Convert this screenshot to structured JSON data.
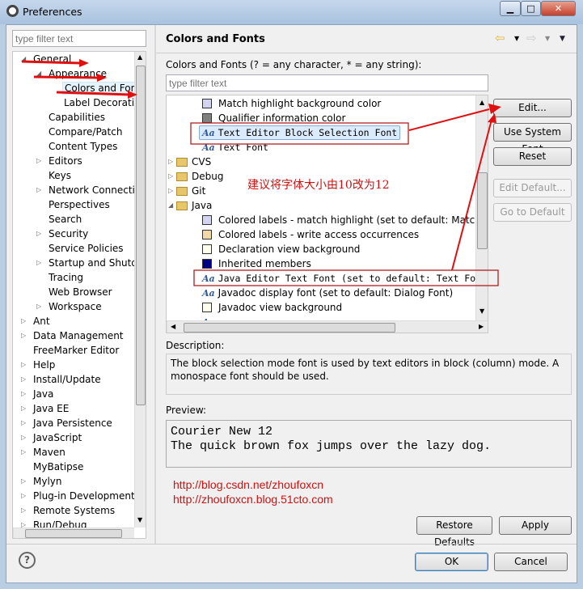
{
  "window": {
    "title": "Preferences",
    "minimize": "▁",
    "maximize": "□",
    "close": "✕"
  },
  "left": {
    "filter_placeholder": "type filter text",
    "tree": [
      {
        "label": "General",
        "level": 0,
        "state": "open"
      },
      {
        "label": "Appearance",
        "level": 1,
        "state": "open"
      },
      {
        "label": "Colors and Fonts",
        "level": 2,
        "state": "leaf",
        "selected": true
      },
      {
        "label": "Label Decorations",
        "level": 2,
        "state": "leaf"
      },
      {
        "label": "Capabilities",
        "level": 1,
        "state": "leaf"
      },
      {
        "label": "Compare/Patch",
        "level": 1,
        "state": "leaf"
      },
      {
        "label": "Content Types",
        "level": 1,
        "state": "leaf"
      },
      {
        "label": "Editors",
        "level": 1,
        "state": "closed"
      },
      {
        "label": "Keys",
        "level": 1,
        "state": "leaf"
      },
      {
        "label": "Network Connections",
        "level": 1,
        "state": "closed"
      },
      {
        "label": "Perspectives",
        "level": 1,
        "state": "leaf"
      },
      {
        "label": "Search",
        "level": 1,
        "state": "leaf"
      },
      {
        "label": "Security",
        "level": 1,
        "state": "closed"
      },
      {
        "label": "Service Policies",
        "level": 1,
        "state": "leaf"
      },
      {
        "label": "Startup and Shutdown",
        "level": 1,
        "state": "closed"
      },
      {
        "label": "Tracing",
        "level": 1,
        "state": "leaf"
      },
      {
        "label": "Web Browser",
        "level": 1,
        "state": "leaf"
      },
      {
        "label": "Workspace",
        "level": 1,
        "state": "closed"
      },
      {
        "label": "Ant",
        "level": 0,
        "state": "closed"
      },
      {
        "label": "Data Management",
        "level": 0,
        "state": "closed"
      },
      {
        "label": "FreeMarker Editor",
        "level": 0,
        "state": "leaf"
      },
      {
        "label": "Help",
        "level": 0,
        "state": "closed"
      },
      {
        "label": "Install/Update",
        "level": 0,
        "state": "closed"
      },
      {
        "label": "Java",
        "level": 0,
        "state": "closed"
      },
      {
        "label": "Java EE",
        "level": 0,
        "state": "closed"
      },
      {
        "label": "Java Persistence",
        "level": 0,
        "state": "closed"
      },
      {
        "label": "JavaScript",
        "level": 0,
        "state": "closed"
      },
      {
        "label": "Maven",
        "level": 0,
        "state": "closed"
      },
      {
        "label": "MyBatipse",
        "level": 0,
        "state": "leaf"
      },
      {
        "label": "Mylyn",
        "level": 0,
        "state": "closed"
      },
      {
        "label": "Plug-in Development",
        "level": 0,
        "state": "closed"
      },
      {
        "label": "Remote Systems",
        "level": 0,
        "state": "closed"
      },
      {
        "label": "Run/Debug",
        "level": 0,
        "state": "closed"
      }
    ]
  },
  "main": {
    "title": "Colors and Fonts",
    "hint": "Colors and Fonts (? = any character, * = any string):",
    "filter_placeholder": "type filter text",
    "items": [
      {
        "type": "color",
        "label": "Match highlight background color",
        "color": "#d4d4f0",
        "indent": 2
      },
      {
        "type": "color",
        "label": "Qualifier information color",
        "color": "#808080",
        "indent": 2
      },
      {
        "type": "font",
        "label": "Text Editor Block Selection Font",
        "mono": true,
        "selected": true,
        "indent": 2
      },
      {
        "type": "font",
        "label": "Text Font",
        "mono": true,
        "indent": 2
      },
      {
        "type": "category",
        "label": "CVS",
        "state": "closed"
      },
      {
        "type": "category",
        "label": "Debug",
        "state": "closed"
      },
      {
        "type": "category",
        "label": "Git",
        "state": "closed"
      },
      {
        "type": "category",
        "label": "Java",
        "state": "open"
      },
      {
        "type": "color",
        "label": "Colored labels - match highlight (set to default: Match highl",
        "color": "#d4d4f0",
        "indent": 2
      },
      {
        "type": "color",
        "label": "Colored labels - write access occurrences",
        "color": "#f0d8a8",
        "indent": 2
      },
      {
        "type": "color",
        "label": "Declaration view background",
        "color": "#fffff0",
        "indent": 2
      },
      {
        "type": "color",
        "label": "Inherited members",
        "color": "#000080",
        "indent": 2
      },
      {
        "type": "font",
        "label": "Java Editor Text Font (set to default: Text Font)",
        "mono": true,
        "indent": 2
      },
      {
        "type": "font",
        "label": "Javadoc display font (set to default: Dialog Font)",
        "indent": 2
      },
      {
        "type": "color",
        "label": "Javadoc view background",
        "color": "#fffff0",
        "indent": 2
      },
      {
        "type": "font",
        "label": "",
        "indent": 2
      }
    ],
    "buttons": {
      "edit": "Edit...",
      "use_system_font": "Use System Font",
      "reset": "Reset",
      "edit_default": "Edit Default...",
      "go_to_default": "Go to Default"
    },
    "description_label": "Description:",
    "description": "The block selection mode font is used by text editors in block (column) mode. A monospace font should be used.",
    "preview_label": "Preview:",
    "preview_lines": [
      "Courier New 12",
      "The quick brown fox jumps over the lazy dog."
    ],
    "restore_defaults": "Restore Defaults",
    "apply": "Apply"
  },
  "annotations": {
    "note": "建议将字体大小由10改为12",
    "urls": [
      "http://blog.csdn.net/zhoufoxcn",
      "http://zhoufoxcn.blog.51cto.com"
    ],
    "color": "#d01010"
  },
  "footer": {
    "help": "?",
    "ok": "OK",
    "cancel": "Cancel"
  },
  "icons": {
    "back": "back-arrow-icon",
    "forward": "forward-arrow-icon",
    "menu": "view-menu-icon"
  }
}
